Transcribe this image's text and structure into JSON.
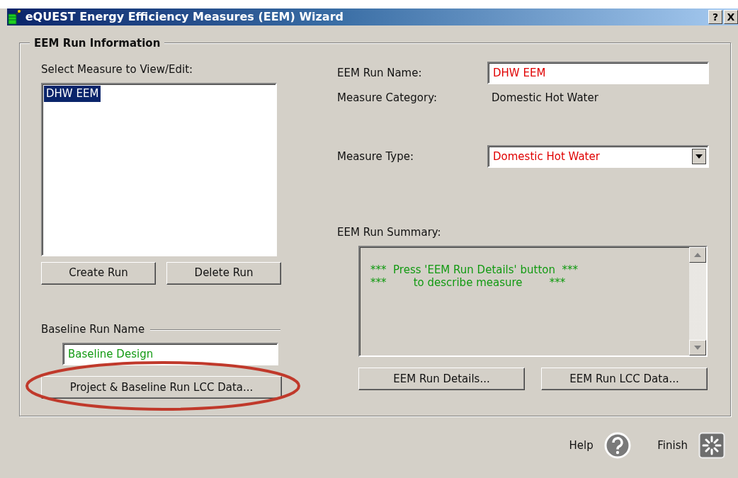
{
  "window": {
    "title": "eQUEST Energy Efficiency Measures (EEM) Wizard",
    "buttons": [
      "?",
      "X"
    ]
  },
  "group": {
    "title": "EEM Run Information"
  },
  "measures": {
    "label": "Select Measure to View/Edit:",
    "items": [
      {
        "label": "DHW EEM",
        "selected": true
      }
    ]
  },
  "list_buttons": [
    "Create Run",
    "Delete Run"
  ],
  "baseline": {
    "label": "Baseline Run Name",
    "value": "Baseline Design",
    "button": "Project & Baseline Run LCC Data...",
    "highlighted": true
  },
  "run_name": {
    "label": "EEM Run Name:",
    "value": "DHW EEM"
  },
  "category": {
    "label": "Measure Category:",
    "value": "Domestic Hot Water"
  },
  "measure_type": {
    "label": "Measure Type:",
    "value": "Domestic Hot Water"
  },
  "summary": {
    "label": "EEM Run Summary:",
    "lines": [
      "***  Press 'EEM Run Details' button  ***",
      "***        to describe measure        ***"
    ]
  },
  "summary_buttons": [
    "EEM Run Details...",
    "EEM Run LCC Data..."
  ],
  "footer": [
    {
      "label": "Help",
      "kind": "help"
    },
    {
      "label": "Finish",
      "kind": "finish"
    }
  ]
}
